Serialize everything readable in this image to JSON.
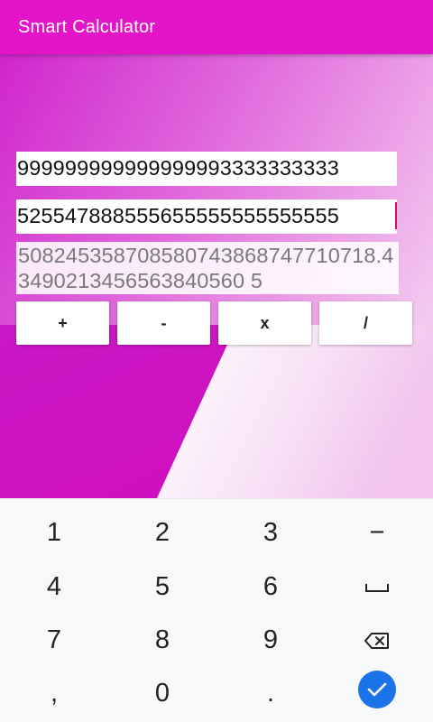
{
  "app": {
    "title": "Smart Calculator"
  },
  "inputs": {
    "first_number": "999999999999999993333333333",
    "second_number": "525547888555655555555555555"
  },
  "result": {
    "value": "508245358708580743868747710718.43490213456563840560 5"
  },
  "operations": [
    {
      "label": "+"
    },
    {
      "label": "-"
    },
    {
      "label": "x"
    },
    {
      "label": "/"
    }
  ],
  "keyboard": {
    "rows": [
      [
        "1",
        "2",
        "3",
        "−"
      ],
      [
        "4",
        "5",
        "6",
        "space-icon"
      ],
      [
        "7",
        "8",
        "9",
        "backspace-icon"
      ],
      [
        ",",
        "0",
        ".",
        "done-icon"
      ]
    ],
    "keys": {
      "k1": "1",
      "k2": "2",
      "k3": "3",
      "minus": "−",
      "k4": "4",
      "k5": "5",
      "k6": "6",
      "k7": "7",
      "k8": "8",
      "k9": "9",
      "comma": ",",
      "k0": "0",
      "period": "."
    }
  },
  "colors": {
    "appbar": "#e414c8",
    "background_gradient_start": "#d020c8",
    "background_gradient_end": "#f0c0ec",
    "done_key": "#1a73e8",
    "caret": "#d0105a"
  }
}
